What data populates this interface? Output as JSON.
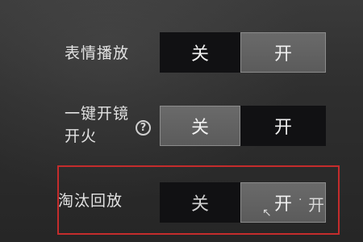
{
  "settings": [
    {
      "label": "表情播放",
      "off_label": "关",
      "on_label": "开",
      "selected": "on"
    },
    {
      "label_line1": "一键开镜",
      "label_line2": "开火",
      "help_icon": "?",
      "off_label": "关",
      "on_label": "开",
      "selected": "off"
    },
    {
      "label": "淘汰回放",
      "off_label": "关",
      "on_label": "开",
      "selected": "on",
      "edge_glyph": "开"
    }
  ],
  "colors": {
    "highlight_border": "#c42c2c",
    "selected_bg": "#5f5f5f",
    "unselected_bg": "#111113"
  }
}
